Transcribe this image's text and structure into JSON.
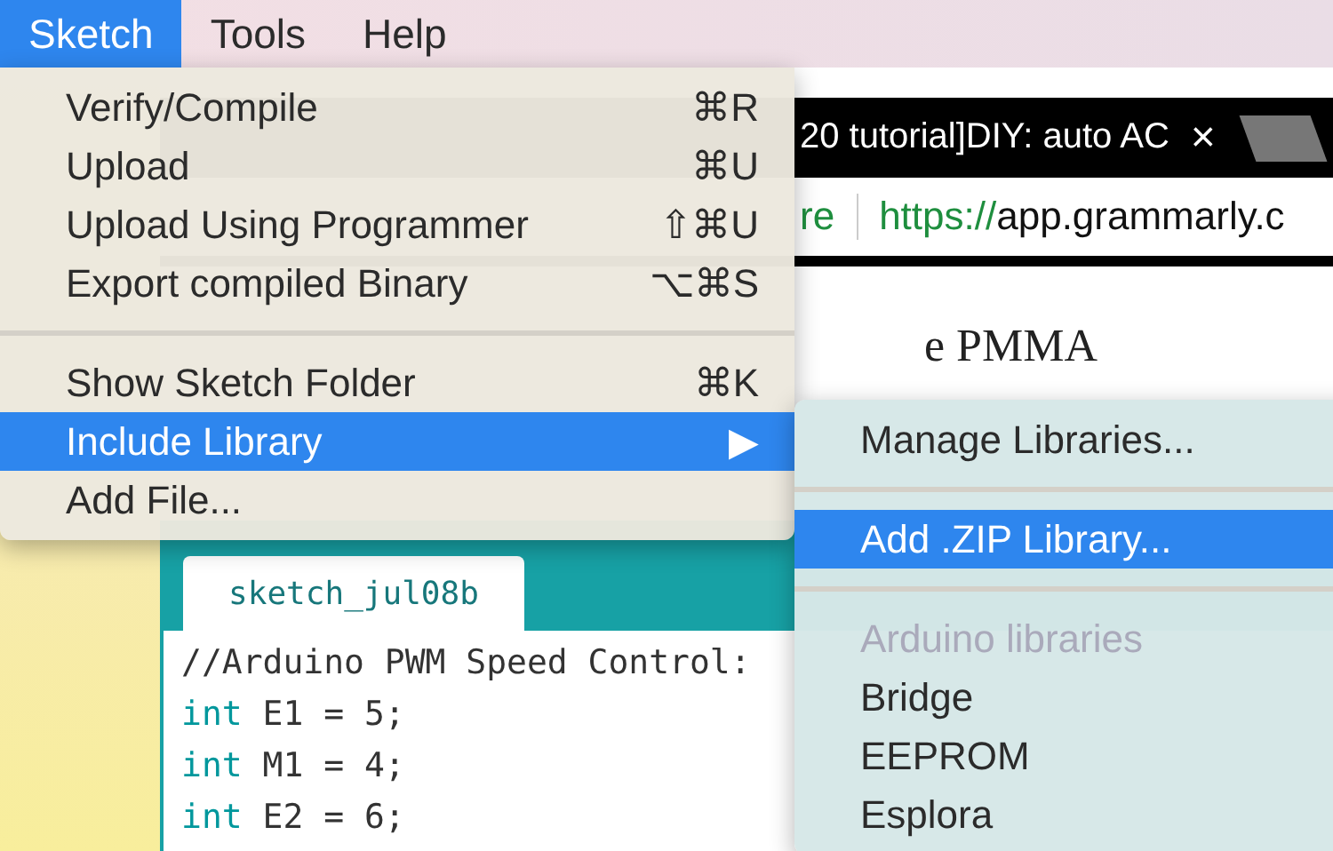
{
  "menu_bar": [
    {
      "label": "Sketch",
      "selected": true
    },
    {
      "label": "Tools",
      "selected": false
    },
    {
      "label": "Help",
      "selected": false
    }
  ],
  "sketch_menu": {
    "items": [
      {
        "kind": "item",
        "label": "Verify/Compile",
        "shortcut": "⌘R",
        "selected": false
      },
      {
        "kind": "item",
        "label": "Upload",
        "shortcut": "⌘U",
        "selected": false
      },
      {
        "kind": "item",
        "label": "Upload Using Programmer",
        "shortcut": "⇧⌘U",
        "selected": false
      },
      {
        "kind": "item",
        "label": "Export compiled Binary",
        "shortcut": "⌥⌘S",
        "selected": false
      },
      {
        "kind": "separator"
      },
      {
        "kind": "item",
        "label": "Show Sketch Folder",
        "shortcut": "⌘K",
        "selected": false
      },
      {
        "kind": "submenu",
        "label": "Include Library",
        "arrow": "▶",
        "selected": true
      },
      {
        "kind": "item",
        "label": "Add File...",
        "selected": false
      }
    ]
  },
  "library_submenu": {
    "items": [
      {
        "kind": "item",
        "label": "Manage Libraries...",
        "selected": false
      },
      {
        "kind": "separator"
      },
      {
        "kind": "item",
        "label": "Add .ZIP Library...",
        "selected": true
      },
      {
        "kind": "separator"
      },
      {
        "kind": "header",
        "label": "Arduino libraries"
      },
      {
        "kind": "item",
        "label": "Bridge",
        "selected": false
      },
      {
        "kind": "item",
        "label": "EEPROM",
        "selected": false
      },
      {
        "kind": "item",
        "label": "Esplora",
        "selected": false
      }
    ]
  },
  "browser": {
    "tab_title": "20 tutorial]DIY: auto AC",
    "tab_close": "×",
    "address_prefix": "re",
    "url_scheme": "https://",
    "url_rest": "app.grammarly.c",
    "page_heading": "e PMMA"
  },
  "editor": {
    "tab": "sketch_jul08b",
    "lines": [
      {
        "rest": "//Arduino PWM Speed Control:"
      },
      {
        "keyword": "int",
        "rest": " E1 = 5;"
      },
      {
        "keyword": "int",
        "rest": " M1 = 4;"
      },
      {
        "keyword": "int",
        "rest": " E2 = 6;"
      }
    ]
  }
}
